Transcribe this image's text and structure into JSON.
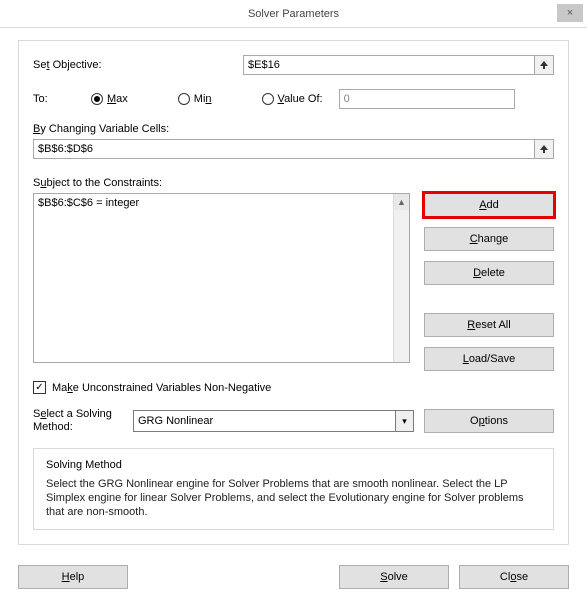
{
  "title": "Solver Parameters",
  "labels": {
    "setObjective_pre": "Se",
    "setObjective_u": "t",
    "setObjective_post": " Objective:",
    "to": "To:",
    "max_u": "M",
    "max_post": "ax",
    "min_pre": "Mi",
    "min_u": "n",
    "valof_u": "V",
    "valof_post": "alue Of:",
    "bychg_u": "B",
    "bychg_post": "y Changing Variable Cells:",
    "subject_pre": "S",
    "subject_u": "u",
    "subject_post": "bject to the Constraints:",
    "make_pre": "Ma",
    "make_u": "k",
    "make_post": "e Unconstrained Variables Non-Negative",
    "selmethod_pre": "S",
    "selmethod_u": "e",
    "selmethod_post": "lect a Solving Method:",
    "info_head": "Solving Method",
    "info_body": "Select the GRG Nonlinear engine for Solver Problems that are smooth nonlinear. Select the LP Simplex engine for linear Solver Problems, and select the Evolutionary engine for Solver problems that are non-smooth."
  },
  "values": {
    "objective": "$E$16",
    "valueOf": "0",
    "changing": "$B$6:$D$6",
    "constraint0": "$B$6:$C$6 = integer",
    "method": "GRG Nonlinear",
    "checked": "✓"
  },
  "buttons": {
    "add_u": "A",
    "add_post": "dd",
    "change_u": "C",
    "change_post": "hange",
    "delete_u": "D",
    "delete_post": "elete",
    "reset_u": "R",
    "reset_post": "eset All",
    "load_u": "L",
    "load_post": "oad/Save",
    "options_pre": "O",
    "options_u": "p",
    "options_post": "tions",
    "help_u": "H",
    "help_post": "elp",
    "solve_u": "S",
    "solve_post": "olve",
    "close_pre": "Cl",
    "close_u": "o",
    "close_post": "se"
  }
}
